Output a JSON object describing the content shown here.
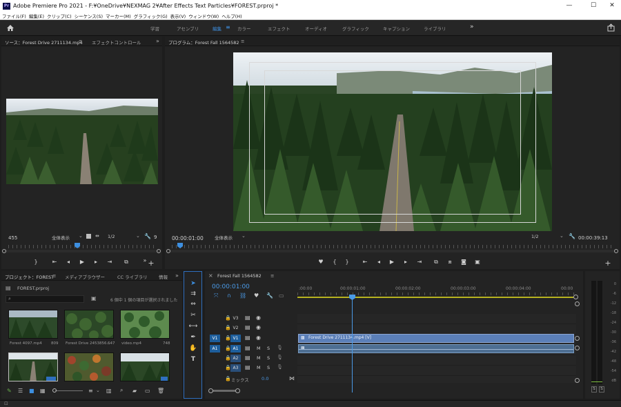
{
  "window": {
    "app_icon": "Pr",
    "title": "Adobe Premiere Pro 2021 - F:¥OneDrive¥NEXMAG 2¥After Effects Text Particles¥FOREST.prproj *",
    "minimize": "—",
    "maximize": "☐",
    "close": "✕"
  },
  "menu": [
    "ファイル(F)",
    "編集(E)",
    "クリップ(C)",
    "シーケンス(S)",
    "マーカー(M)",
    "グラフィック(G)",
    "表示(V)",
    "ウィンドウ(W)",
    "ヘルプ(H)"
  ],
  "workspaces": {
    "items": [
      "学習",
      "アセンブリ",
      "編集",
      "カラー",
      "エフェクト",
      "オーディオ",
      "グラフィック",
      "キャプション",
      "ライブラリ"
    ],
    "active": "編集",
    "more": "»"
  },
  "source_monitor": {
    "tab": "ソース：Forest Drive 2711134.mp4",
    "tab_menu": "≡",
    "other_tab": "エフェクトコントロール",
    "more": "»",
    "timecode": "455",
    "zoom": "全体表示",
    "resolution": "1/2",
    "right_value": "9"
  },
  "program_monitor": {
    "tab": "プログラム：Forest Fall 1564582",
    "tab_menu": "≡",
    "timecode": "00:00:01:00",
    "zoom": "全体表示",
    "resolution": "1/2",
    "duration": "00:00:39:13"
  },
  "project": {
    "tab": "プロジェクト：FOREST",
    "tab_menu": "≡",
    "tabs": [
      "メディアブラウザー",
      "CC ライブラリ",
      "情報"
    ],
    "more": "»",
    "file": "FOREST.prproj",
    "selection_info": "6 個中 1 個の項目が選択されました",
    "items": [
      {
        "name": "Forest 4097.mp4",
        "dur": "809"
      },
      {
        "name": "Forest Drive 2453856...",
        "dur": "647"
      },
      {
        "name": "video.mp4",
        "dur": "748"
      },
      {
        "name": "",
        "dur": ""
      },
      {
        "name": "",
        "dur": ""
      },
      {
        "name": "",
        "dur": ""
      }
    ]
  },
  "timeline": {
    "tab": "Forest Fall 1564582",
    "tab_menu": "≡",
    "timecode": "00:00:01:00",
    "ruler": [
      ":00:00",
      "00:00:01:00",
      "00:00:02:00",
      "00:00:03:00",
      "00:00:04:00",
      "00:00"
    ],
    "video_tracks": [
      "V3",
      "V2",
      "V1"
    ],
    "audio_tracks": [
      "A1",
      "A2",
      "A3"
    ],
    "source_v": "V1",
    "source_a": "A1",
    "mix_label": "ミックス",
    "mix_value": "0.0",
    "clip_label": "Forest Drive 2711134.mp4 [V]",
    "m": "M",
    "s": "S"
  },
  "meter": {
    "labels": [
      "0",
      "-6",
      "-12",
      "-18",
      "-24",
      "-30",
      "-36",
      "-42",
      "-48",
      "-54",
      "dB"
    ],
    "solo": [
      "S",
      "S"
    ]
  },
  "colors": {
    "accent": "#3d8fe0",
    "playhead": "#4a9ae6",
    "clip_video": "#5b7fb8",
    "clip_audio": "#4d6e92"
  }
}
